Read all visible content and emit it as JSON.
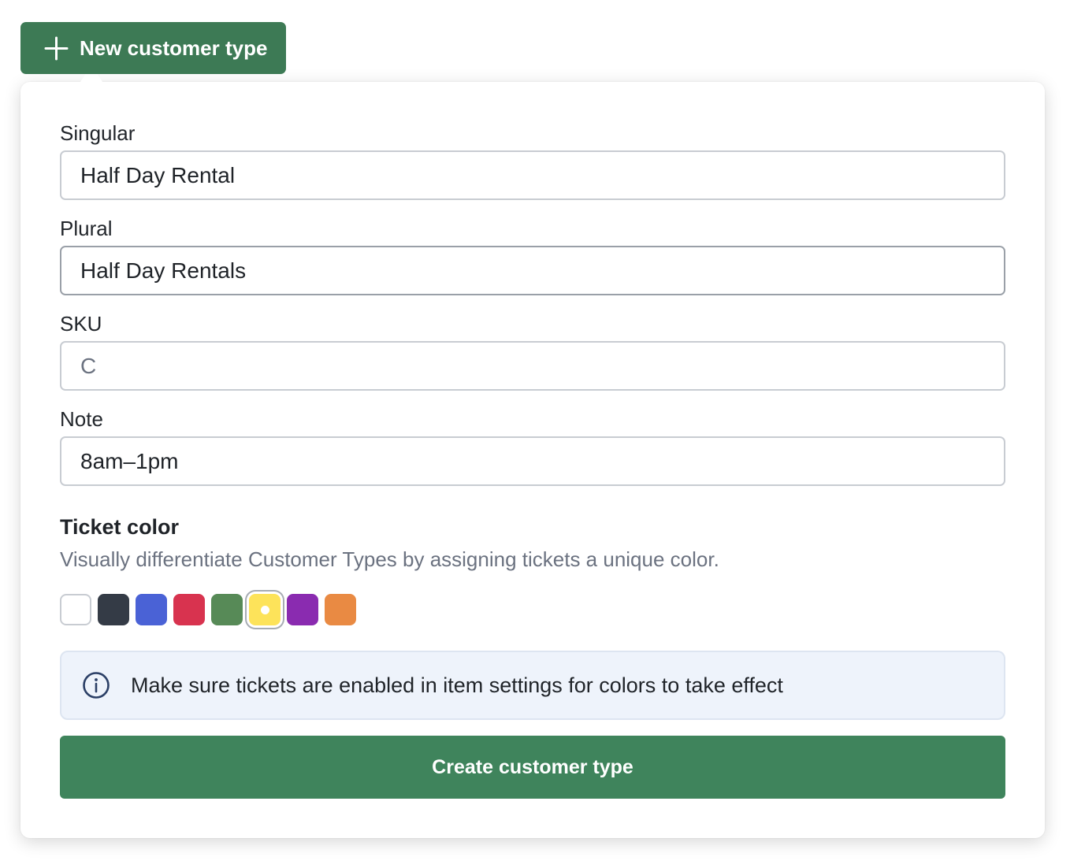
{
  "header": {
    "new_button_label": "New customer type"
  },
  "form": {
    "singular": {
      "label": "Singular",
      "value": "Half Day Rental"
    },
    "plural": {
      "label": "Plural",
      "value": "Half Day Rentals"
    },
    "sku": {
      "label": "SKU",
      "value": "",
      "placeholder": "C"
    },
    "note": {
      "label": "Note",
      "value": "8am–1pm"
    }
  },
  "ticket_color": {
    "title": "Ticket color",
    "description": "Visually differentiate Customer Types by assigning tickets a unique color.",
    "selected": "yellow",
    "swatches": [
      {
        "name": "white",
        "color": "#ffffff"
      },
      {
        "name": "dark-gray",
        "color": "#343b46"
      },
      {
        "name": "blue",
        "color": "#4a62d6"
      },
      {
        "name": "red",
        "color": "#d8334f"
      },
      {
        "name": "green",
        "color": "#578a57"
      },
      {
        "name": "yellow",
        "color": "#fde35a"
      },
      {
        "name": "purple",
        "color": "#8a2bb0"
      },
      {
        "name": "orange",
        "color": "#e98a43"
      }
    ]
  },
  "info": {
    "icon": "info-circle-icon",
    "text": "Make sure tickets are enabled in item settings for colors to take effect"
  },
  "submit": {
    "label": "Create customer type"
  },
  "colors": {
    "primary_green": "#3d7a55",
    "submit_green": "#3f845c",
    "info_bg": "#eef3fb",
    "info_icon": "#2b3f66"
  }
}
